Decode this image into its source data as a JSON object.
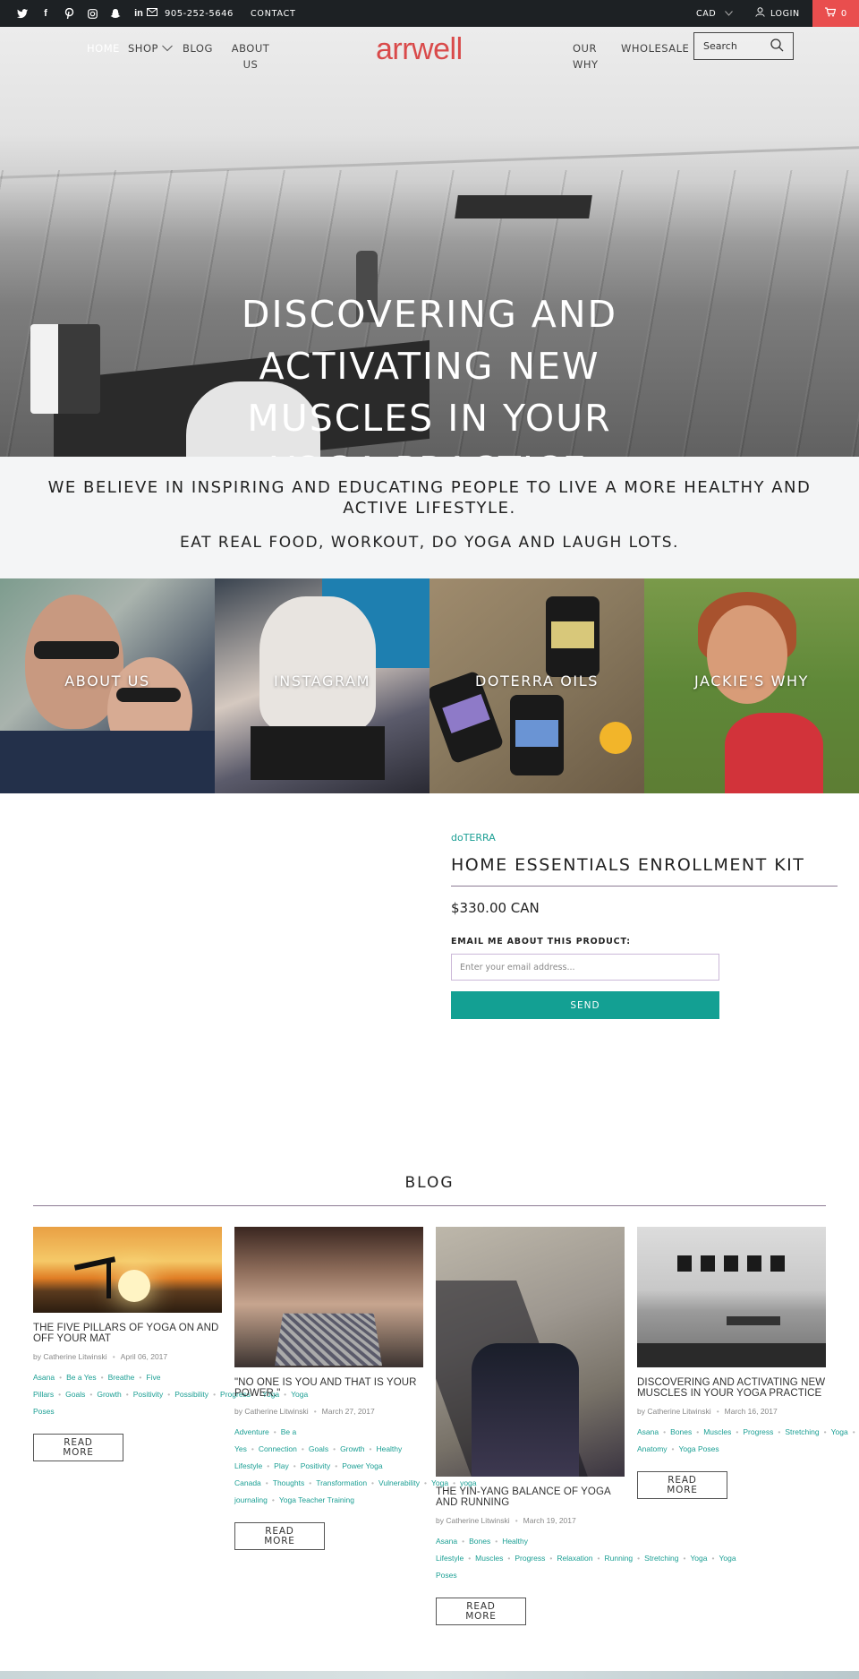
{
  "topbar": {
    "social": [
      "twitter-icon",
      "facebook-icon",
      "pinterest-icon",
      "instagram-icon",
      "snapchat-icon",
      "linkedin-icon"
    ],
    "phone": "905-252-5646",
    "contact": "CONTACT",
    "currency": "CAD",
    "login": "LOGIN",
    "cart_count": "0"
  },
  "nav": {
    "home": "HOME",
    "shop": "SHOP",
    "blog": "BLOG",
    "about": "ABOUT US",
    "logo": "arrwell",
    "our_why": "OUR WHY",
    "wholesale": "WHOLESALE",
    "search_placeholder": "Search"
  },
  "hero": {
    "title": "DISCOVERING AND ACTIVATING NEW MUSCLES IN YOUR YOGA PRACTICE"
  },
  "tagline": {
    "line1": "WE BELIEVE IN INSPIRING AND EDUCATING PEOPLE TO LIVE A MORE HEALTHY AND ACTIVE LIFESTYLE.",
    "line2": "EAT REAL FOOD, WORKOUT, DO YOGA AND LAUGH LOTS."
  },
  "tiles": [
    {
      "label": "ABOUT US"
    },
    {
      "label": "INSTAGRAM"
    },
    {
      "label": "DOTERRA OILS"
    },
    {
      "label": "JACKIE'S WHY"
    }
  ],
  "product": {
    "vendor": "doTERRA",
    "title": "HOME ESSENTIALS ENROLLMENT KIT",
    "price": "$330.00 CAN",
    "email_label": "EMAIL ME ABOUT THIS PRODUCT:",
    "email_placeholder": "Enter your email address...",
    "send": "SEND"
  },
  "blog": {
    "title": "BLOG",
    "posts": [
      {
        "title": "THE FIVE PILLARS OF YOGA ON AND OFF YOUR MAT",
        "author": "by Catherine Litwinski",
        "date": "April 06, 2017",
        "tags": [
          "Asana",
          "Be a Yes",
          "Breathe",
          "Five Pillars",
          "Goals",
          "Growth",
          "Positivity",
          "Possibility",
          "Progress",
          "Yoga",
          "Yoga Poses"
        ],
        "more": "READ MORE"
      },
      {
        "title": "\"NO ONE IS YOU AND THAT IS YOUR POWER.\"",
        "author": "by Catherine Litwinski",
        "date": "March 27, 2017",
        "tags": [
          "Adventure",
          "Be a Yes",
          "Connection",
          "Goals",
          "Growth",
          "Healthy Lifestyle",
          "Play",
          "Positivity",
          "Power Yoga Canada",
          "Thoughts",
          "Transformation",
          "Vulnerability",
          "Yoga",
          "yoga journaling",
          "Yoga Teacher Training"
        ],
        "more": "READ MORE"
      },
      {
        "title": "THE YIN-YANG BALANCE OF YOGA AND RUNNING",
        "author": "by Catherine Litwinski",
        "date": "March 19, 2017",
        "tags": [
          "Asana",
          "Bones",
          "Healthy Lifestyle",
          "Muscles",
          "Progress",
          "Relaxation",
          "Running",
          "Stretching",
          "Yoga",
          "Yoga Poses"
        ],
        "more": "READ MORE"
      },
      {
        "title": "DISCOVERING AND ACTIVATING NEW MUSCLES IN YOUR YOGA PRACTICE",
        "author": "by Catherine Litwinski",
        "date": "March 16, 2017",
        "tags": [
          "Asana",
          "Bones",
          "Muscles",
          "Progress",
          "Stretching",
          "Yoga",
          "Yoga Anatomy",
          "Yoga Poses"
        ],
        "more": "READ MORE"
      }
    ]
  }
}
